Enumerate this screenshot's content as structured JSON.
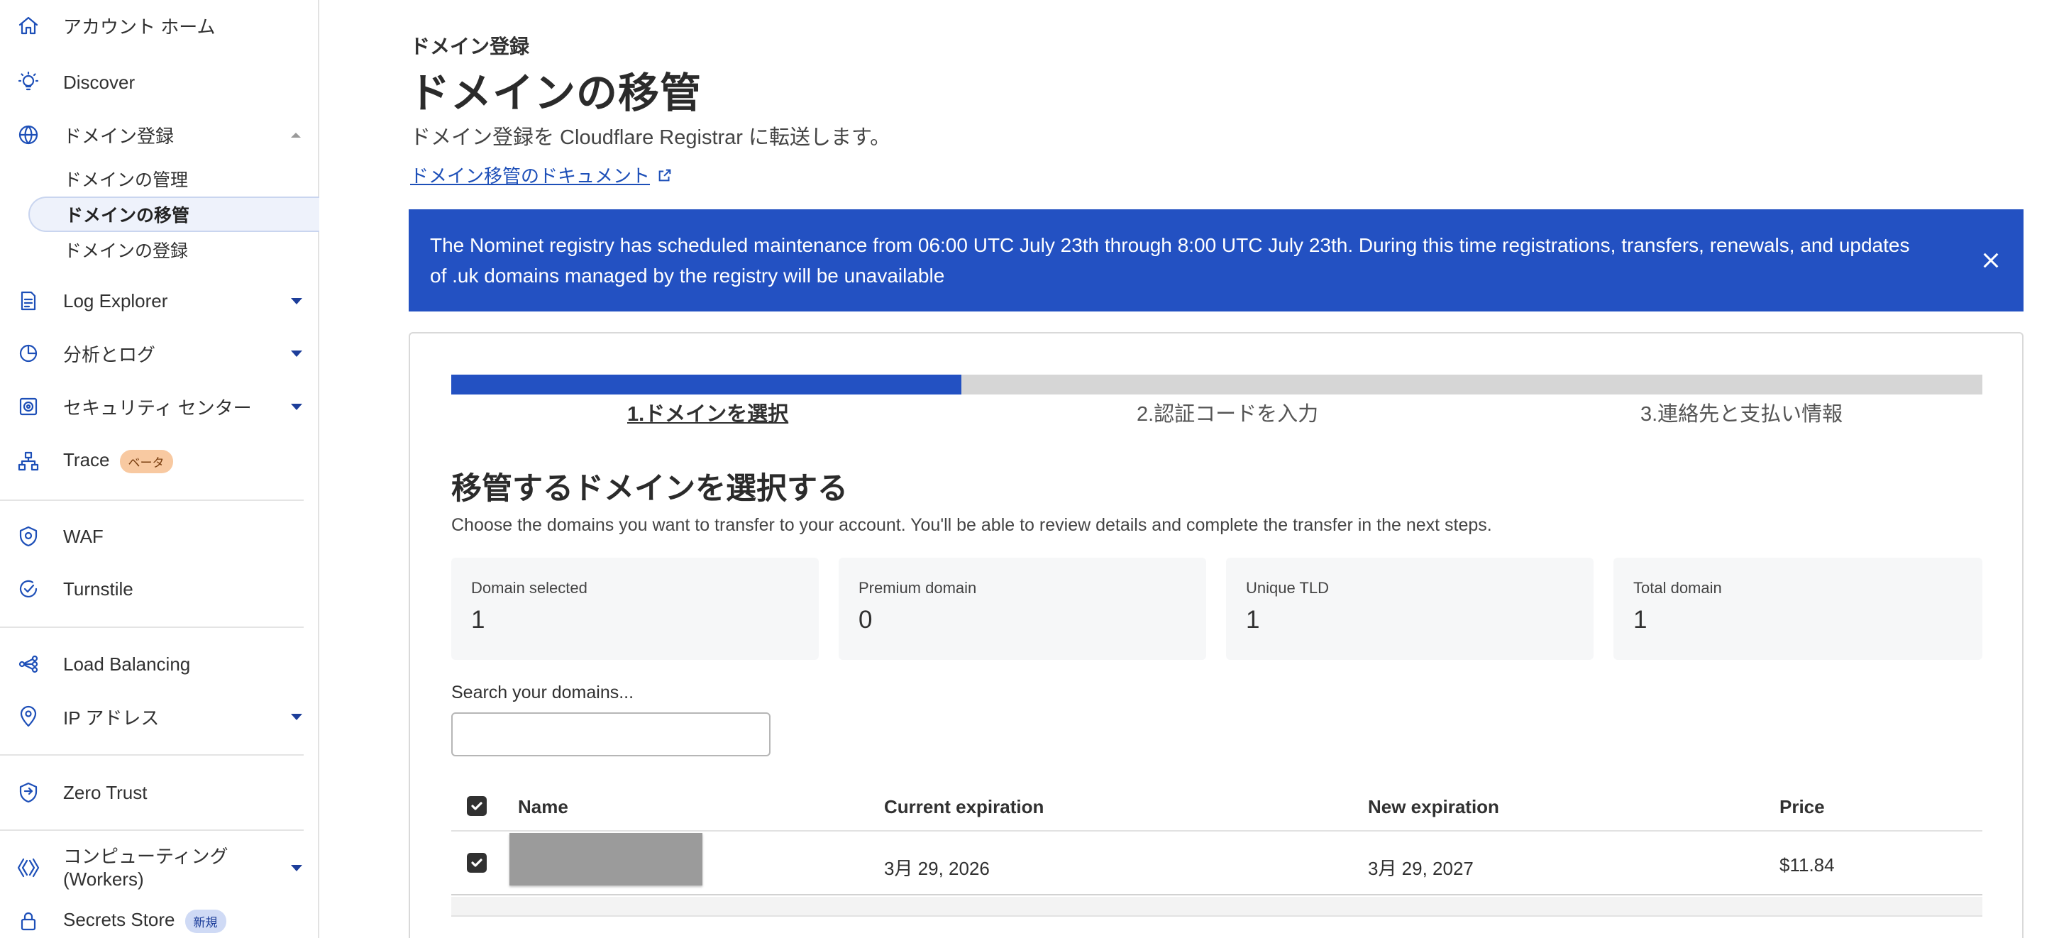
{
  "sidebar": {
    "items": [
      {
        "label": "アカウント ホーム",
        "icon": "home-icon"
      },
      {
        "label": "Discover",
        "icon": "lightbulb-icon"
      },
      {
        "label": "ドメイン登録",
        "icon": "globe-icon"
      },
      {
        "label": "Log Explorer",
        "icon": "log-explorer-icon"
      },
      {
        "label": "分析とログ",
        "icon": "pie-chart-icon"
      },
      {
        "label": "セキュリティ センター",
        "icon": "security-center-icon"
      },
      {
        "label": "Trace",
        "icon": "trace-icon",
        "badge": "ベータ"
      },
      {
        "label": "WAF",
        "icon": "waf-shield-icon"
      },
      {
        "label": "Turnstile",
        "icon": "turnstile-icon"
      },
      {
        "label": "Load Balancing",
        "icon": "load-balancing-icon"
      },
      {
        "label": "IP アドレス",
        "icon": "location-pin-icon"
      },
      {
        "label": "Zero Trust",
        "icon": "zero-trust-icon"
      },
      {
        "label": "コンピューティング\n(Workers)",
        "icon": "workers-icon"
      },
      {
        "label": "Secrets Store",
        "icon": "lock-icon",
        "badge": "新規"
      }
    ],
    "domain_sub_items": [
      "ドメインの管理",
      "ドメインの移管",
      "ドメインの登録"
    ]
  },
  "header": {
    "breadcrumb": "ドメイン登録",
    "title": "ドメインの移管",
    "description": "ドメイン登録を Cloudflare Registrar に転送します。",
    "doc_link": "ドメイン移管のドキュメント"
  },
  "banner": {
    "text": "The Nominet registry has scheduled maintenance from 06:00 UTC July 23th through 8:00 UTC July 23th. During this time registrations, transfers, renewals, and updates of .uk domains managed by the registry will be unavailable"
  },
  "wizard": {
    "progress_fraction": 0.333,
    "steps": [
      "1.ドメインを選択",
      "2.認証コードを入力",
      "3.連絡先と支払い情報"
    ]
  },
  "selection": {
    "title": "移管するドメインを選択する",
    "description": "Choose the domains you want to transfer to your account. You'll be able to review details and complete the transfer in the next steps.",
    "stats": [
      {
        "label": "Domain selected",
        "value": "1"
      },
      {
        "label": "Premium domain",
        "value": "0"
      },
      {
        "label": "Unique TLD",
        "value": "1"
      },
      {
        "label": "Total domain",
        "value": "1"
      }
    ],
    "search_label": "Search your domains...",
    "search_value": ""
  },
  "table": {
    "columns": [
      "Name",
      "Current expiration",
      "New expiration",
      "Price"
    ],
    "rows": [
      {
        "name": "",
        "current_expiration": "3月 29, 2026",
        "new_expiration": "3月 29, 2027",
        "price": "$11.84",
        "checked": true
      }
    ]
  },
  "colors": {
    "accent": "#2351c2",
    "icon": "#1d4fb8",
    "text": "#313131"
  }
}
